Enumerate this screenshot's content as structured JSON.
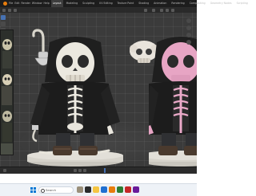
{
  "topbar": {
    "menu": [
      "File",
      "Edit",
      "Render",
      "Window",
      "Help"
    ],
    "workspaces": [
      "Layout",
      "Modeling",
      "Sculpting",
      "UV Editing",
      "Texture Paint",
      "Shading",
      "Animation",
      "Rendering",
      "Compositing",
      "Geometry Nodes",
      "Scripting"
    ],
    "active_workspace_index": 0
  },
  "taskbar": {
    "search_placeholder": "Search",
    "time": "",
    "date": ""
  },
  "colors": {
    "viewport_bg": "#3b3b3b",
    "accent_blue": "#4772b3",
    "windows_blue": "#0078d4",
    "skull_white": "#e8e4d8",
    "skull_pink": "#e7a5c4",
    "jacket": "#1c1c1c"
  }
}
